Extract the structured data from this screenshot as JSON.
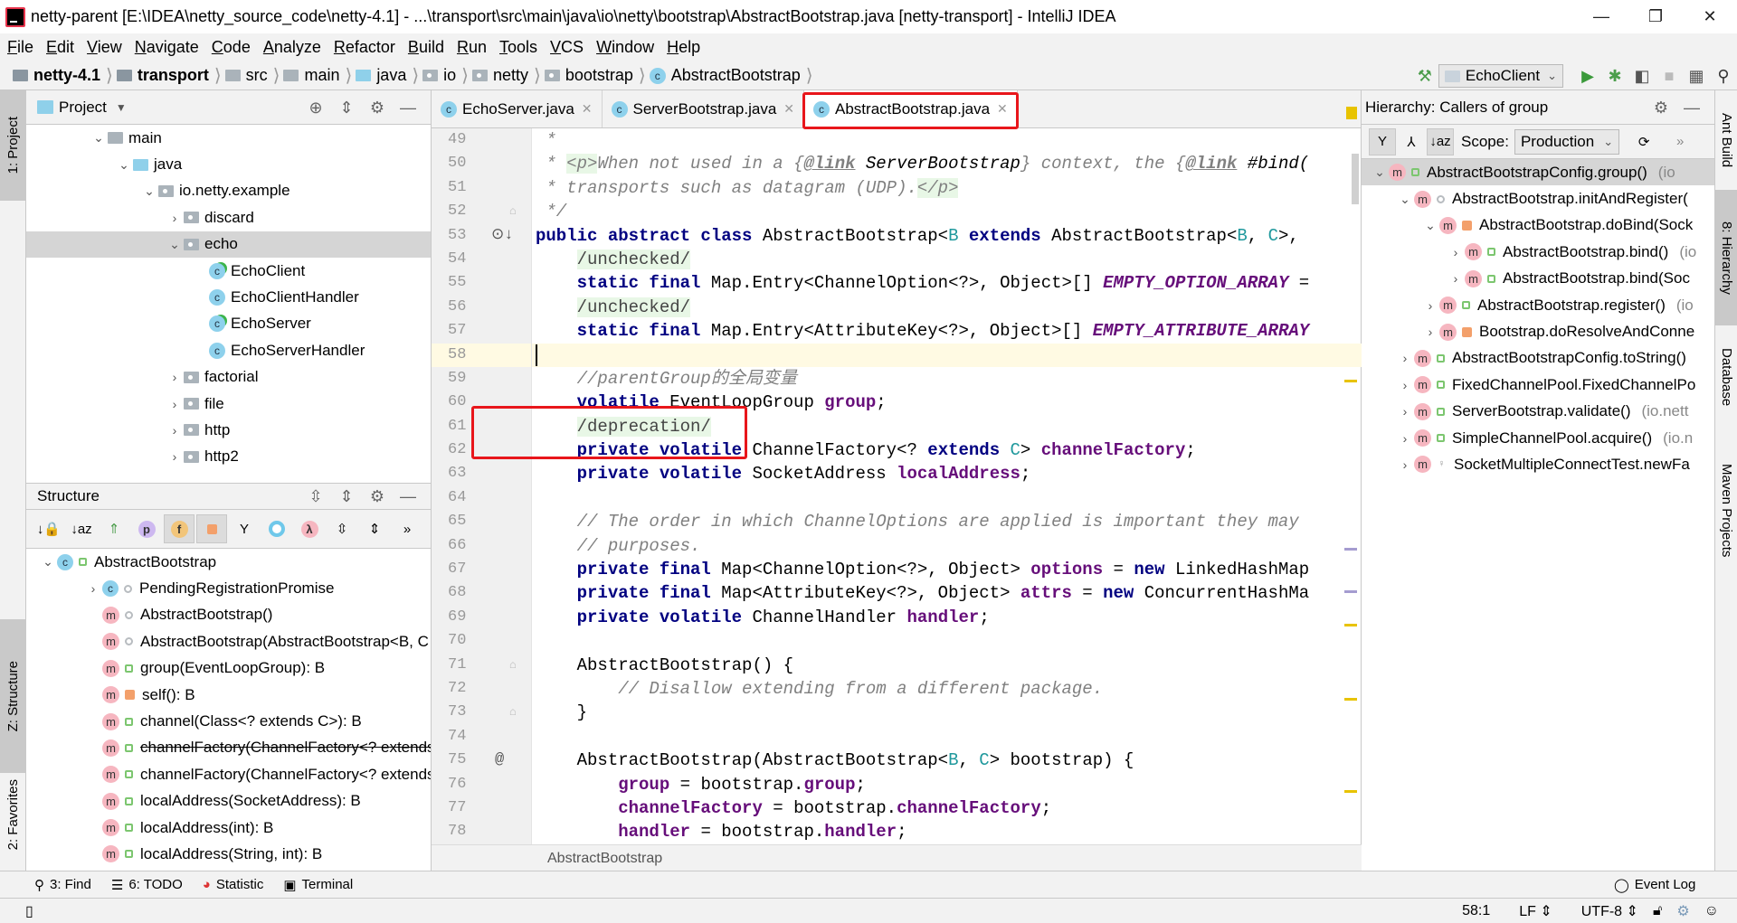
{
  "window": {
    "title": "netty-parent [E:\\IDEA\\netty_source_code\\netty-4.1] - ...\\transport\\src\\main\\java\\io\\netty\\bootstrap\\AbstractBootstrap.java [netty-transport] - IntelliJ IDEA",
    "minimize": "—",
    "maximize": "❐",
    "close": "✕"
  },
  "menu": [
    "File",
    "Edit",
    "View",
    "Navigate",
    "Code",
    "Analyze",
    "Refactor",
    "Build",
    "Run",
    "Tools",
    "VCS",
    "Window",
    "Help"
  ],
  "breadcrumb": [
    {
      "label": "netty-4.1",
      "icon": "module",
      "bold": true
    },
    {
      "label": "transport",
      "icon": "module",
      "bold": true
    },
    {
      "label": "src",
      "icon": "folder"
    },
    {
      "label": "main",
      "icon": "folder"
    },
    {
      "label": "java",
      "icon": "source-folder"
    },
    {
      "label": "io",
      "icon": "package"
    },
    {
      "label": "netty",
      "icon": "package"
    },
    {
      "label": "bootstrap",
      "icon": "package"
    },
    {
      "label": "AbstractBootstrap",
      "icon": "class"
    }
  ],
  "run": {
    "config": "EchoClient"
  },
  "left_strip": {
    "project": "1: Project",
    "structure": "Z: Structure",
    "favorites": "2: Favorites"
  },
  "right_strip": {
    "ant": "Ant Build",
    "hierarchy": "8: Hierarchy",
    "database": "Database",
    "maven": "Maven Projects"
  },
  "project": {
    "title": "Project",
    "items": [
      {
        "label": "main",
        "level": 3,
        "chev": "v",
        "icon": "folder"
      },
      {
        "label": "java",
        "level": 4,
        "chev": "v",
        "icon": "source-folder"
      },
      {
        "label": "io.netty.example",
        "level": 5,
        "chev": "v",
        "icon": "package"
      },
      {
        "label": "discard",
        "level": 6,
        "chev": ">",
        "icon": "package"
      },
      {
        "label": "echo",
        "level": 6,
        "chev": "v",
        "icon": "package",
        "selected": true
      },
      {
        "label": "EchoClient",
        "level": 7,
        "icon": "class-runnable"
      },
      {
        "label": "EchoClientHandler",
        "level": 7,
        "icon": "class"
      },
      {
        "label": "EchoServer",
        "level": 7,
        "icon": "class-runnable"
      },
      {
        "label": "EchoServerHandler",
        "level": 7,
        "icon": "class"
      },
      {
        "label": "factorial",
        "level": 6,
        "chev": ">",
        "icon": "package"
      },
      {
        "label": "file",
        "level": 6,
        "chev": ">",
        "icon": "package"
      },
      {
        "label": "http",
        "level": 6,
        "chev": ">",
        "icon": "package"
      },
      {
        "label": "http2",
        "level": 6,
        "chev": ">",
        "icon": "package"
      }
    ]
  },
  "structure": {
    "title": "Structure",
    "items": [
      {
        "label": "AbstractBootstrap",
        "level": 0,
        "chev": "v",
        "icon": "class",
        "vis": "pub"
      },
      {
        "label": "PendingRegistrationPromise",
        "level": 1,
        "chev": ">",
        "icon": "class",
        "vis": "pkg"
      },
      {
        "label": "AbstractBootstrap()",
        "level": 1,
        "icon": "method",
        "vis": "pkg"
      },
      {
        "label": "AbstractBootstrap(AbstractBootstrap<B, C",
        "level": 1,
        "icon": "method",
        "vis": "pkg"
      },
      {
        "label": "group(EventLoopGroup): B",
        "level": 1,
        "icon": "method",
        "vis": "pub"
      },
      {
        "label": "self(): B",
        "level": 1,
        "icon": "method",
        "vis": "priv"
      },
      {
        "label": "channel(Class<? extends C>): B",
        "level": 1,
        "icon": "method",
        "vis": "pub"
      },
      {
        "label": "channelFactory(ChannelFactory<? extends",
        "level": 1,
        "icon": "method",
        "vis": "pub",
        "deprecated": true
      },
      {
        "label": "channelFactory(ChannelFactory<? extends",
        "level": 1,
        "icon": "method",
        "vis": "pub"
      },
      {
        "label": "localAddress(SocketAddress): B",
        "level": 1,
        "icon": "method",
        "vis": "pub"
      },
      {
        "label": "localAddress(int): B",
        "level": 1,
        "icon": "method",
        "vis": "pub"
      },
      {
        "label": "localAddress(String, int): B",
        "level": 1,
        "icon": "method",
        "vis": "pub"
      }
    ]
  },
  "editor": {
    "tabs": [
      {
        "label": "EchoServer.java",
        "active": false
      },
      {
        "label": "ServerBootstrap.java",
        "active": false
      },
      {
        "label": "AbstractBootstrap.java",
        "active": true
      }
    ],
    "breadcrumb": "AbstractBootstrap",
    "current_line": 58,
    "lines": [
      {
        "n": 49,
        "t": [
          [
            " *",
            "cm"
          ]
        ]
      },
      {
        "n": 50,
        "t": [
          [
            " * ",
            "cm"
          ],
          [
            "<p>",
            "tg"
          ],
          [
            "When not used in a {",
            "cm"
          ],
          [
            "@link",
            "lk"
          ],
          [
            " ServerBootstrap",
            "dc"
          ],
          [
            "} context, the {",
            "cm"
          ],
          [
            "@link",
            "lk"
          ],
          [
            " #bind(",
            "dc"
          ]
        ]
      },
      {
        "n": 51,
        "t": [
          [
            " * transports such as datagram (UDP).",
            "cm"
          ],
          [
            "</p>",
            "tg"
          ]
        ]
      },
      {
        "n": 52,
        "t": [
          [
            " */",
            "cm"
          ]
        ],
        "g": "fold"
      },
      {
        "n": 53,
        "t": [
          [
            "public abstract class ",
            "kw"
          ],
          [
            "AbstractBootstrap<",
            ""
          ],
          [
            "B",
            "tp"
          ],
          [
            " extends ",
            "kw"
          ],
          [
            "AbstractBootstrap<",
            ""
          ],
          [
            "B",
            "tp"
          ],
          [
            ", ",
            ""
          ],
          [
            "C",
            "tp"
          ],
          [
            ">,",
            ""
          ]
        ],
        "g": "impl"
      },
      {
        "n": 54,
        "t": [
          [
            "    ",
            ""
          ],
          [
            "/unchecked/",
            "an"
          ]
        ]
      },
      {
        "n": 55,
        "t": [
          [
            "    static final ",
            "kw"
          ],
          [
            "Map.Entry<ChannelOption<?>, Object>[] ",
            ""
          ],
          [
            "EMPTY_OPTION_ARRAY",
            "cst"
          ],
          [
            " =",
            ""
          ]
        ]
      },
      {
        "n": 56,
        "t": [
          [
            "    ",
            ""
          ],
          [
            "/unchecked/",
            "an"
          ]
        ]
      },
      {
        "n": 57,
        "t": [
          [
            "    static final ",
            "kw"
          ],
          [
            "Map.Entry<AttributeKey<?>, Object>[] ",
            ""
          ],
          [
            "EMPTY_ATTRIBUTE_ARRAY",
            "cst"
          ]
        ]
      },
      {
        "n": 58,
        "t": [
          [
            "",
            ""
          ]
        ]
      },
      {
        "n": 59,
        "t": [
          [
            "    //parentGroup的全局变量",
            "cm"
          ]
        ]
      },
      {
        "n": 60,
        "t": [
          [
            "    volatile ",
            "kw"
          ],
          [
            "EventLoopGroup ",
            ""
          ],
          [
            "group",
            "fld"
          ],
          [
            ";",
            ""
          ]
        ]
      },
      {
        "n": 61,
        "t": [
          [
            "    ",
            ""
          ],
          [
            "/deprecation/",
            "an"
          ]
        ]
      },
      {
        "n": 62,
        "t": [
          [
            "    private volatile ",
            "kw"
          ],
          [
            "ChannelFactory<? ",
            ""
          ],
          [
            "extends ",
            "kw"
          ],
          [
            "C",
            "tp"
          ],
          [
            "> ",
            ""
          ],
          [
            "channelFactory",
            "fld"
          ],
          [
            ";",
            ""
          ]
        ]
      },
      {
        "n": 63,
        "t": [
          [
            "    private volatile ",
            "kw"
          ],
          [
            "SocketAddress ",
            ""
          ],
          [
            "localAddress",
            "fld"
          ],
          [
            ";",
            ""
          ]
        ]
      },
      {
        "n": 64,
        "t": [
          [
            "",
            ""
          ]
        ]
      },
      {
        "n": 65,
        "t": [
          [
            "    // The order in which ChannelOptions are applied is important they may",
            "cm"
          ]
        ]
      },
      {
        "n": 66,
        "t": [
          [
            "    // purposes.",
            "cm"
          ]
        ]
      },
      {
        "n": 67,
        "t": [
          [
            "    private final ",
            "kw"
          ],
          [
            "Map<ChannelOption<?>, Object> ",
            ""
          ],
          [
            "options",
            "fld"
          ],
          [
            " = ",
            ""
          ],
          [
            "new ",
            "kw"
          ],
          [
            "LinkedHashMap",
            ""
          ]
        ]
      },
      {
        "n": 68,
        "t": [
          [
            "    private final ",
            "kw"
          ],
          [
            "Map<AttributeKey<?>, Object> ",
            ""
          ],
          [
            "attrs",
            "fld"
          ],
          [
            " = ",
            ""
          ],
          [
            "new ",
            "kw"
          ],
          [
            "ConcurrentHashMa",
            ""
          ]
        ]
      },
      {
        "n": 69,
        "t": [
          [
            "    private volatile ",
            "kw"
          ],
          [
            "ChannelHandler ",
            ""
          ],
          [
            "handler",
            "fld"
          ],
          [
            ";",
            ""
          ]
        ]
      },
      {
        "n": 70,
        "t": [
          [
            "",
            ""
          ]
        ]
      },
      {
        "n": 71,
        "t": [
          [
            "    AbstractBootstrap() {",
            ""
          ]
        ],
        "g": "fold"
      },
      {
        "n": 72,
        "t": [
          [
            "        // Disallow extending from a different package.",
            "cm"
          ]
        ]
      },
      {
        "n": 73,
        "t": [
          [
            "    }",
            ""
          ]
        ],
        "g": "fold"
      },
      {
        "n": 74,
        "t": [
          [
            "",
            ""
          ]
        ]
      },
      {
        "n": 75,
        "t": [
          [
            "    AbstractBootstrap(AbstractBootstrap<",
            ""
          ],
          [
            "B",
            "tp"
          ],
          [
            ", ",
            ""
          ],
          [
            "C",
            "tp"
          ],
          [
            "> bootstrap) {",
            ""
          ]
        ],
        "g": "at"
      },
      {
        "n": 76,
        "t": [
          [
            "        ",
            ""
          ],
          [
            "group",
            "fld"
          ],
          [
            " = bootstrap.",
            ""
          ],
          [
            "group",
            "fld"
          ],
          [
            ";",
            ""
          ]
        ]
      },
      {
        "n": 77,
        "t": [
          [
            "        ",
            ""
          ],
          [
            "channelFactory",
            "fld"
          ],
          [
            " = bootstrap.",
            ""
          ],
          [
            "channelFactory",
            "fld"
          ],
          [
            ";",
            ""
          ]
        ]
      },
      {
        "n": 78,
        "t": [
          [
            "        ",
            ""
          ],
          [
            "handler",
            "fld"
          ],
          [
            " = bootstrap.",
            ""
          ],
          [
            "handler",
            "fld"
          ],
          [
            ";",
            ""
          ]
        ]
      }
    ]
  },
  "hierarchy": {
    "title": "Hierarchy:",
    "subject": "Callers of group",
    "scope_label": "Scope:",
    "scope": "Production",
    "items": [
      {
        "label": "AbstractBootstrapConfig.group()",
        "pkg": "(io",
        "level": 0,
        "chev": "v",
        "vis": "pub",
        "selected": true
      },
      {
        "label": "AbstractBootstrap.initAndRegister(",
        "level": 1,
        "chev": "v",
        "vis": "pkg"
      },
      {
        "label": "AbstractBootstrap.doBind(Sock",
        "level": 2,
        "chev": "v",
        "vis": "priv"
      },
      {
        "label": "AbstractBootstrap.bind()",
        "pkg": "(io",
        "level": 3,
        "chev": ">",
        "vis": "pub"
      },
      {
        "label": "AbstractBootstrap.bind(Soc",
        "level": 3,
        "chev": ">",
        "vis": "pub"
      },
      {
        "label": "AbstractBootstrap.register()",
        "pkg": "(io",
        "level": 2,
        "chev": ">",
        "vis": "pub"
      },
      {
        "label": "Bootstrap.doResolveAndConne",
        "level": 2,
        "chev": ">",
        "vis": "priv"
      },
      {
        "label": "AbstractBootstrapConfig.toString()",
        "level": 1,
        "chev": ">",
        "vis": "pub"
      },
      {
        "label": "FixedChannelPool.FixedChannelPo",
        "level": 1,
        "chev": ">",
        "vis": "pub"
      },
      {
        "label": "ServerBootstrap.validate()",
        "pkg": "(io.nett",
        "level": 1,
        "chev": ">",
        "vis": "pub"
      },
      {
        "label": "SimpleChannelPool.acquire()",
        "pkg": "(io.n",
        "level": 1,
        "chev": ">",
        "vis": "pub"
      },
      {
        "label": "SocketMultipleConnectTest.newFa",
        "level": 1,
        "chev": ">",
        "vis": "prot"
      }
    ]
  },
  "tool_windows": {
    "find": "3: Find",
    "todo": "6: TODO",
    "statistic": "Statistic",
    "terminal": "Terminal",
    "event_log": "Event Log"
  },
  "status": {
    "position": "58:1",
    "line_sep": "LF",
    "encoding": "UTF-8"
  },
  "colors": {
    "highlight_box": "#e8161b",
    "current_line": "#fffae3",
    "keyword": "#000080",
    "field": "#660e7a",
    "comment": "#808080"
  }
}
